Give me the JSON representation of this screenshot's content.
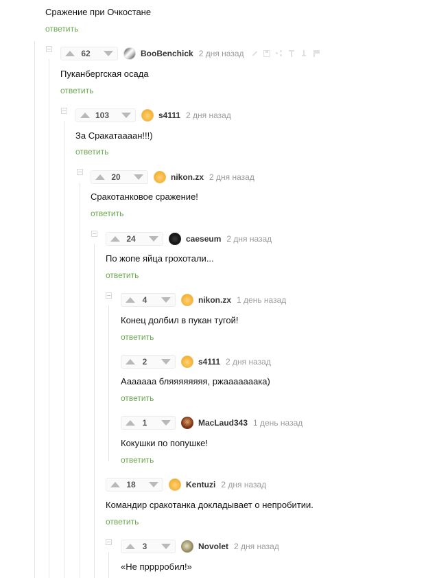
{
  "parent": {
    "text": "Сражение при Очкостане",
    "reply_label": "ответить"
  },
  "comments": [
    {
      "rating": "62",
      "user": "BooBenchick",
      "time": "2 дня назад",
      "text": "Пуканбергская осада",
      "reply_label": "ответить",
      "avatar": "avatar-mixed"
    },
    {
      "rating": "103",
      "user": "s4111",
      "time": "2 дня назад",
      "text": "За Сракатаааан!!!)",
      "reply_label": "ответить",
      "avatar": "avatar-yellow"
    },
    {
      "rating": "20",
      "user": "nikon.zx",
      "time": "2 дня назад",
      "text": "Сракотанковое сражение!",
      "reply_label": "ответить",
      "avatar": "avatar-yellow"
    },
    {
      "rating": "24",
      "user": "caeseum",
      "time": "2 дня назад",
      "text": "По жопе яйца грохотали...",
      "reply_label": "ответить",
      "avatar": "avatar-dark"
    },
    {
      "rating": "4",
      "user": "nikon.zx",
      "time": "1 день назад",
      "text": "Конец долбил в пукан тугой!",
      "reply_label": "ответить",
      "avatar": "avatar-yellow"
    },
    {
      "rating": "2",
      "user": "s4111",
      "time": "2 дня назад",
      "text": "Ааааааа бляяяяяяяя, ржааааааака)",
      "reply_label": "ответить",
      "avatar": "avatar-yellow"
    },
    {
      "rating": "1",
      "user": "MacLaud343",
      "time": "1 день назад",
      "text": "Кокушки по попушке!",
      "reply_label": "ответить",
      "avatar": "avatar-red"
    },
    {
      "rating": "18",
      "user": "Kentuzi",
      "time": "2 дня назад",
      "text": "Командир сракотанка докладывает о непробитии.",
      "reply_label": "ответить",
      "avatar": "avatar-yellow"
    },
    {
      "rating": "3",
      "user": "Novolet",
      "time": "2 дня назад",
      "text": "«Не прррробил!»",
      "reply_label": "",
      "avatar": "avatar-olive"
    }
  ],
  "colors": {
    "reply": "#6aa84f",
    "time": "#9a9a9a",
    "thread_line": "#e6e6e6"
  },
  "icons": [
    "upvote-icon",
    "downvote-icon",
    "collapse-icon",
    "edit-icon",
    "save-icon",
    "share-icon",
    "arrow-up-icon",
    "arrow-down-icon",
    "flag-icon"
  ]
}
